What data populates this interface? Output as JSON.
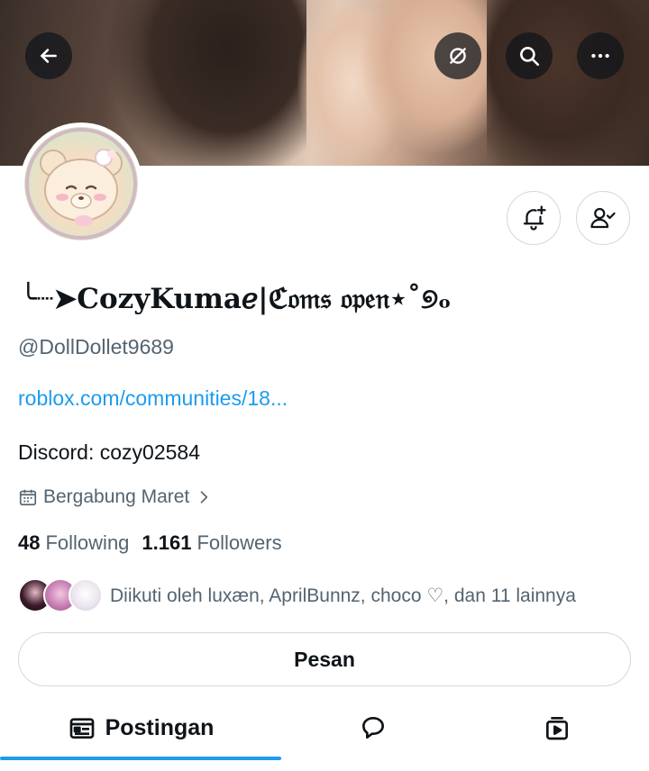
{
  "header": {
    "back_icon": "arrow-left-icon",
    "grok_icon": "grok-icon",
    "search_icon": "search-icon",
    "more_icon": "more-horizontal-icon"
  },
  "profile": {
    "display_name": "╰┈➤CozyKumaℯ|ℭ𝔬𝔪𝔰 𝔬𝔭𝔢𝔫⋆˚୭ₒ",
    "handle": "@DollDollet9689",
    "link": "roblox.com/communities/18...",
    "bio": "Discord: cozy02584",
    "joined": "Bergabung Maret"
  },
  "stats": {
    "following_count": "48",
    "following_label": "Following",
    "followers_count": "1.161",
    "followers_label": "Followers"
  },
  "followed_by": {
    "text": "Diikuti oleh luxæn, AprilBunnz, choco ♡, dan 11 lainnya"
  },
  "actions": {
    "notify_icon": "bell-plus-icon",
    "following_icon": "person-check-icon",
    "message_label": "Pesan"
  },
  "tabs": {
    "posts_label": "Postingan",
    "replies_icon": "speech-bubble-icon",
    "media_icon": "video-icon"
  },
  "colors": {
    "accent": "#1d9bf0",
    "text_primary": "#0f1419",
    "text_secondary": "#536471",
    "border": "#cfd9de"
  }
}
